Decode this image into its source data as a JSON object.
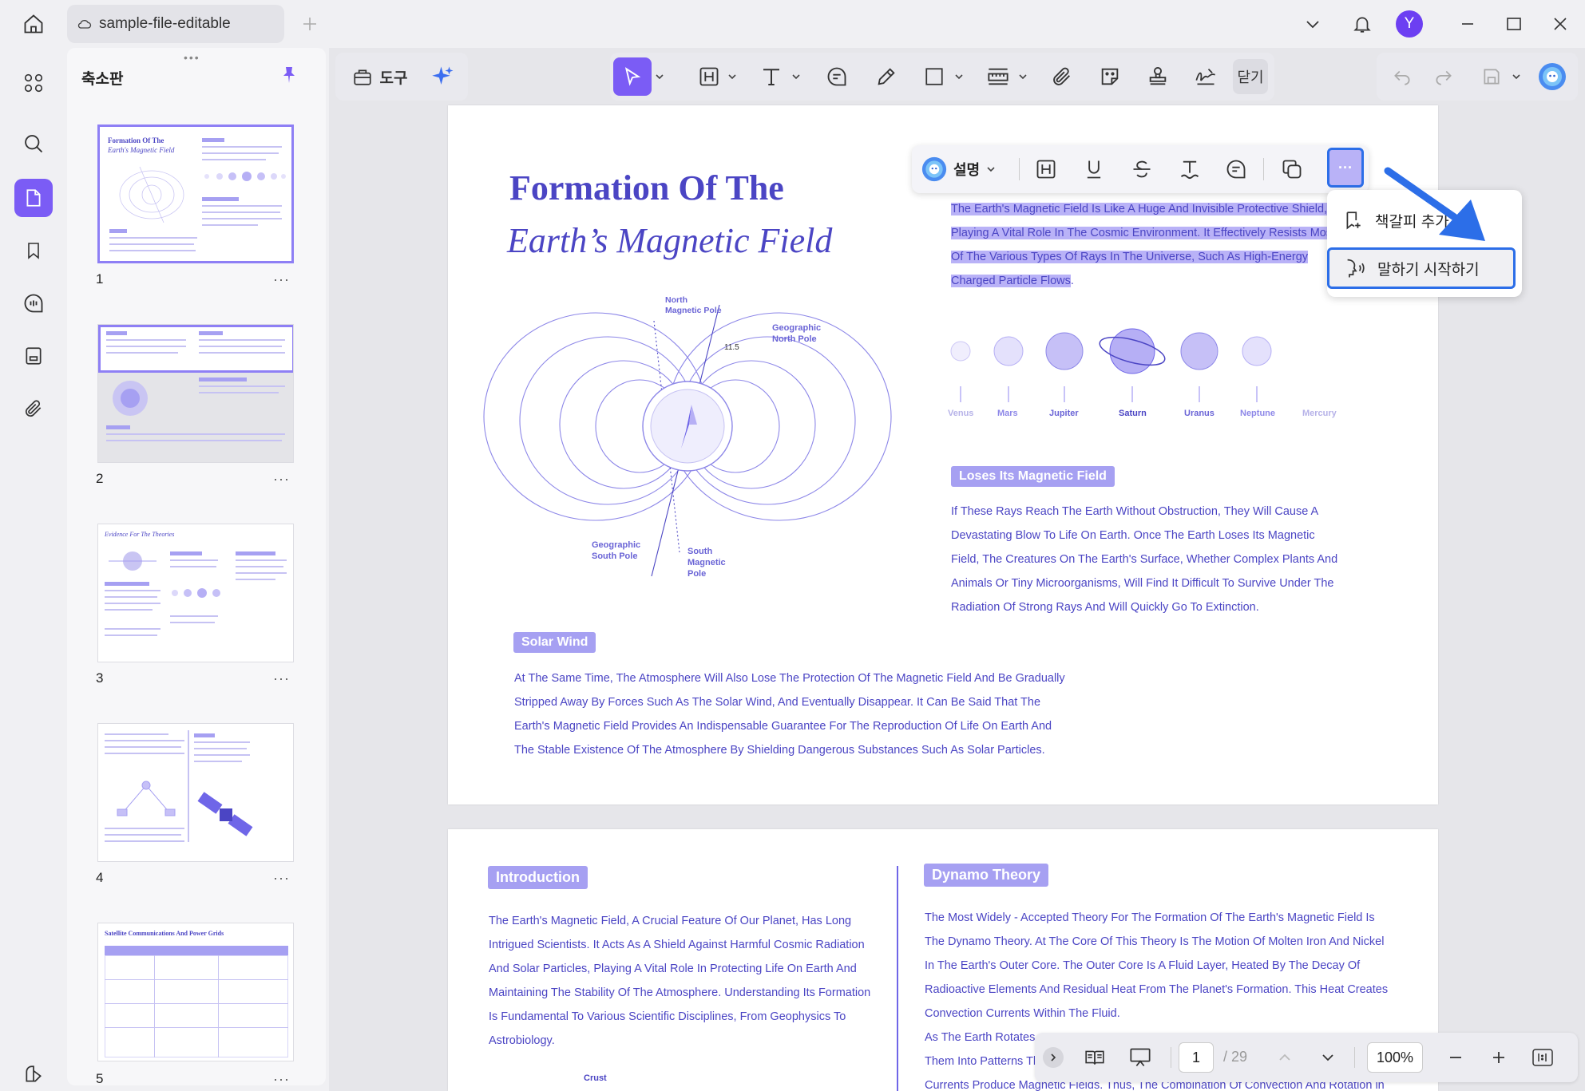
{
  "titlebar": {
    "tab_title": "sample-file-editable",
    "avatar_letter": "Y"
  },
  "thumbnails": {
    "title": "축소판",
    "pages": [
      {
        "number": "1",
        "heading": "Formation Of The",
        "subheading": "Earth's Magnetic Field"
      },
      {
        "number": "2"
      },
      {
        "number": "3",
        "heading": "Evidence For The Theories"
      },
      {
        "number": "4"
      },
      {
        "number": "5",
        "heading": "Satellite Communications And Power Grids"
      }
    ],
    "more": "···"
  },
  "toolbar": {
    "tools_label": "도구",
    "close_label": "닫기"
  },
  "floatbar": {
    "explain_label": "설명",
    "more": "···"
  },
  "context_menu": {
    "items": [
      "책갈피 추가",
      "말하기 시작하기"
    ]
  },
  "page1": {
    "title_line1": "Formation Of The",
    "title_line2": "Earth’s Magnetic Field",
    "selected_text": [
      "The Earth's Magnetic Field Is Like A Huge And Invisible Protective Shield,",
      "Playing A Vital Role In The Cosmic Environment. It Effectively Resists Most",
      "Of The Various Types Of Rays In The Universe, Such As High-Energy",
      "Charged Particle Flows"
    ],
    "selected_tail": ".",
    "diagram_labels": {
      "north_magnetic_pole": [
        "North",
        "Magnetic Pole"
      ],
      "geographic_north_pole": [
        "Geographic",
        "North Pole"
      ],
      "angle": "11.5",
      "geographic_south_pole": [
        "Geographic",
        "South Pole"
      ],
      "south_magnetic_pole": [
        "South",
        "Magnetic",
        "Pole"
      ]
    },
    "planets": [
      "Venus",
      "Mars",
      "Jupiter",
      "Saturn",
      "Uranus",
      "Neptune",
      "Mercury"
    ],
    "loses_heading": "Loses Its Magnetic Field",
    "loses_text": [
      "If These Rays Reach The Earth Without Obstruction, They Will Cause A",
      "Devastating Blow To Life On Earth. Once The Earth Loses Its Magnetic",
      "Field, The Creatures On The Earth's Surface, Whether Complex Plants And",
      "Animals Or Tiny Microorganisms, Will Find It Difficult To Survive Under The",
      "Radiation Of Strong Rays And Will Quickly Go To Extinction."
    ],
    "solar_heading": "Solar Wind",
    "solar_text": [
      "At The Same Time, The Atmosphere Will Also Lose The Protection Of The Magnetic Field And Be Gradually",
      "Stripped Away By Forces Such As The Solar Wind, And Eventually Disappear. It Can Be Said That The",
      "Earth's Magnetic Field Provides An Indispensable Guarantee For The Reproduction Of Life On Earth And",
      "The Stable Existence Of The Atmosphere By Shielding Dangerous Substances Such As Solar Particles."
    ]
  },
  "page2": {
    "intro_heading": "Introduction",
    "intro_text": [
      "The Earth's Magnetic Field, A Crucial Feature Of Our Planet, Has Long",
      "Intrigued Scientists. It Acts As A Shield Against Harmful Cosmic Radiation",
      "And Solar Particles, Playing A Vital Role In Protecting Life On Earth And",
      "Maintaining The Stability Of The Atmosphere. Understanding Its Formation",
      "Is Fundamental To Various Scientific Disciplines, From Geophysics To",
      "Astrobiology."
    ],
    "crust_label": "Crust",
    "dynamo_heading": "Dynamo Theory",
    "dynamo_text": [
      "The Most Widely - Accepted Theory For The Formation Of The Earth's Magnetic Field Is",
      "The Dynamo Theory. At The Core Of This Theory Is The Motion Of Molten Iron And Nickel",
      "In The Earth's Outer Core. The Outer Core Is A Fluid Layer, Heated By The Decay Of",
      "Radioactive Elements And Residual Heat From The Planet's Formation. This Heat Creates",
      "Convection Currents Within The Fluid.",
      "As The Earth Rotates,",
      "Them Into Patterns Th",
      "Currents Produce Magnetic Fields. Thus, The Combination Of Convection And Rotation in"
    ]
  },
  "bottombar": {
    "page_current": "1",
    "page_total": "/ 29",
    "zoom": "100%"
  },
  "colors": {
    "accent": "#7b5cf5",
    "text_blue": "#4b45c4",
    "badge": "#a6a0f2",
    "highlight": "#b9b2f7",
    "callout_blue": "#2c6ee8"
  }
}
